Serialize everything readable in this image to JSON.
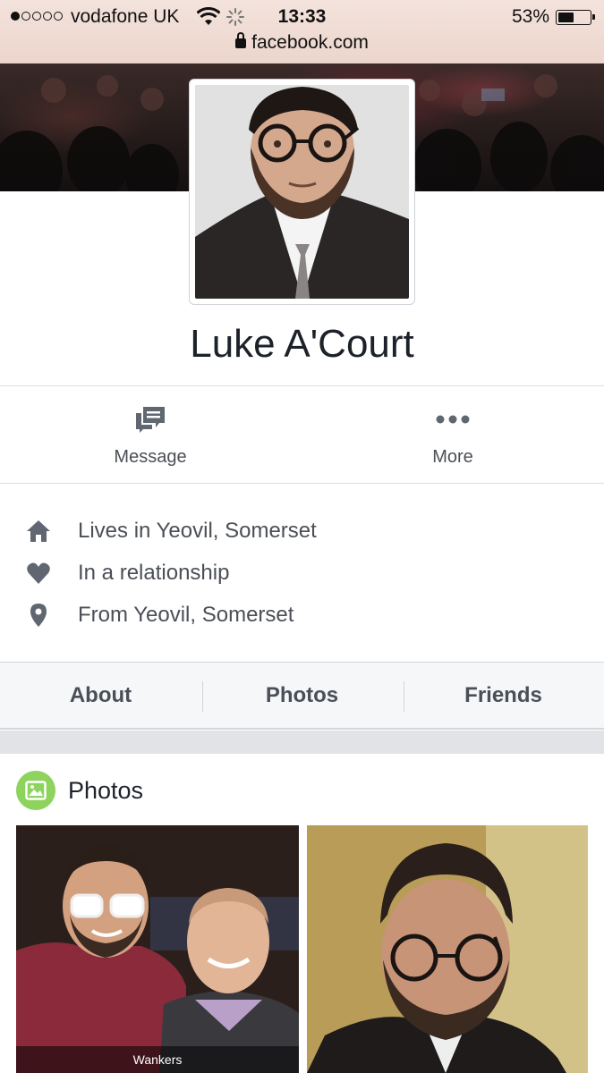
{
  "status_bar": {
    "carrier": "vodafone UK",
    "time": "13:33",
    "battery_percent": "53%",
    "battery_level": 0.53,
    "signal_bars_filled": 1,
    "signal_bars_total": 5
  },
  "browser": {
    "url": "facebook.com"
  },
  "profile": {
    "name": "Luke A'Court"
  },
  "actions": {
    "message_label": "Message",
    "more_label": "More"
  },
  "intro": [
    {
      "icon": "home-icon",
      "text": "Lives in Yeovil, Somerset"
    },
    {
      "icon": "heart-icon",
      "text": "In a relationship"
    },
    {
      "icon": "location-pin-icon",
      "text": "From Yeovil, Somerset"
    }
  ],
  "tabs": [
    "About",
    "Photos",
    "Friends"
  ],
  "photos_section": {
    "title": "Photos",
    "thumbnails": [
      {
        "caption": "Wankers"
      },
      {
        "caption": ""
      }
    ]
  },
  "colors": {
    "icon_gray": "#606770",
    "photos_badge": "#8dd35e",
    "tab_bg": "#f6f7f9"
  }
}
